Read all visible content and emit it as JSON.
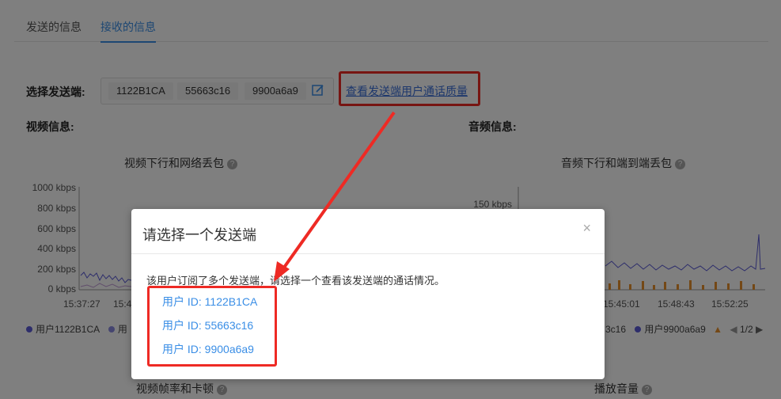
{
  "tabs": [
    {
      "label": "发送的信息"
    },
    {
      "label": "接收的信息"
    }
  ],
  "selector": {
    "label": "选择发送端:",
    "chips": [
      "1122B1CA",
      "55663c16",
      "9900a6a9"
    ],
    "quality_link": "查看发送端用户通话质量"
  },
  "video": {
    "section_label": "视频信息:",
    "chart_title": "视频下行和网络丢包",
    "legend": [
      "用户1122B1CA",
      "用"
    ],
    "bottom_title": "视频帧率和卡顿"
  },
  "audio": {
    "section_label": "音频信息:",
    "chart_title": "音频下行和端到端丢包",
    "legend": [
      "3c16",
      "用户9900a6a9",
      "▲"
    ],
    "pager": "1/2",
    "bottom_title": "播放音量"
  },
  "chart_data": [
    {
      "type": "line",
      "title": "视频下行和网络丢包",
      "ylabel_ticks": [
        "1000 kbps",
        "800 kbps",
        "600 kbps",
        "400 kbps",
        "200 kbps",
        "0 kbps"
      ],
      "xlabel_ticks": [
        "15:37:27",
        "15:4"
      ],
      "ylim": [
        0,
        1000
      ],
      "series": [
        {
          "name": "用户1122B1CA",
          "color": "#5b5bd6"
        }
      ]
    },
    {
      "type": "line",
      "title": "音频下行和端到端丢包",
      "ylabel_ticks": [
        "150 kbps"
      ],
      "xlabel_ticks": [
        "15:45:01",
        "15:48:43",
        "15:52:25"
      ],
      "series": [
        {
          "name": "用户9900a6a9",
          "color": "#5b5bd6"
        }
      ]
    }
  ],
  "modal": {
    "title": "请选择一个发送端",
    "close": "×",
    "description": "该用户订阅了多个发送端，请选择一个查看该发送端的通话情况。",
    "users": [
      "用户 ID: 1122B1CA",
      "用户 ID: 55663c16",
      "用户 ID: 9900a6a9"
    ]
  },
  "colors": {
    "accent": "#3a8ee6",
    "annotation": "#ee2a24",
    "series_purple": "#5b5bd6",
    "series_orange": "#e8912d"
  }
}
